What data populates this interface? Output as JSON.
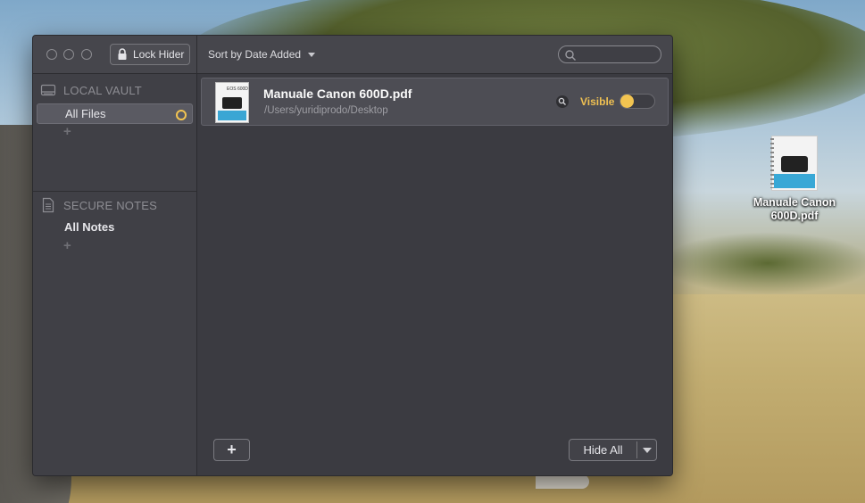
{
  "toolbar": {
    "lock_label": "Lock Hider",
    "sort_label": "Sort by Date Added",
    "search_placeholder": ""
  },
  "sidebar": {
    "local_vault": {
      "heading": "LOCAL VAULT",
      "items": [
        {
          "label": "All Files",
          "selected": true
        }
      ],
      "add_symbol": "+"
    },
    "secure_notes": {
      "heading": "SECURE NOTES",
      "items": [
        {
          "label": "All Notes"
        }
      ],
      "add_symbol": "+"
    }
  },
  "files": [
    {
      "name": "Manuale Canon 600D.pdf",
      "path": "/Users/yuridiprodo/Desktop",
      "status": "Visible",
      "visible": true,
      "thumb_text": "EOS 600D"
    }
  ],
  "footer": {
    "add_symbol": "+",
    "hide_all_label": "Hide All"
  },
  "desktop": {
    "icon_label": "Manuale Canon 600D.pdf",
    "icon_label_line1": "Manuale Canon",
    "icon_label_line2": "600D.pdf"
  },
  "colors": {
    "accent": "#f2c451",
    "window_bg": "#3b3b41",
    "sidebar_bg": "#404046"
  },
  "icons": {
    "lock": "lock-icon",
    "search": "search-icon",
    "vault": "drive-icon",
    "notes": "document-icon",
    "reveal": "magnifier-icon"
  }
}
